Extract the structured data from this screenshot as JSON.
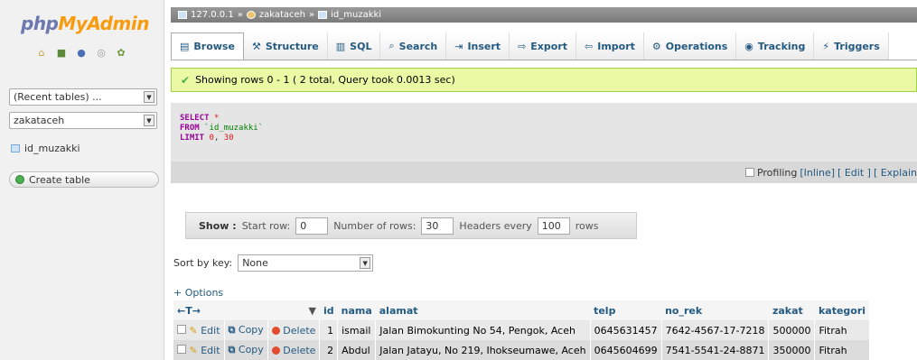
{
  "logo": {
    "part1": "php",
    "part2": "MyAdmin"
  },
  "nav": {
    "icons": [
      "home-icon",
      "exit-icon",
      "help-icon",
      "docs-icon",
      "settings-icon"
    ],
    "recent_tables": "(Recent tables) ...",
    "database": "zakataceh",
    "table": "id_muzakki",
    "create_table": "Create table"
  },
  "breadcrumb": {
    "server": "127.0.0.1",
    "database": "zakataceh",
    "table": "id_muzakki",
    "sep": "»"
  },
  "tabs": [
    {
      "label": "Browse",
      "icon": "▤",
      "active": true
    },
    {
      "label": "Structure",
      "icon": "⚒"
    },
    {
      "label": "SQL",
      "icon": "▥"
    },
    {
      "label": "Search",
      "icon": "⌕"
    },
    {
      "label": "Insert",
      "icon": "⇥"
    },
    {
      "label": "Export",
      "icon": "⇨"
    },
    {
      "label": "Import",
      "icon": "⇦"
    },
    {
      "label": "Operations",
      "icon": "⚙"
    },
    {
      "label": "Tracking",
      "icon": "◉"
    },
    {
      "label": "Triggers",
      "icon": "⚡"
    }
  ],
  "success_message": "Showing rows 0 - 1 ( 2 total, Query took 0.0013 sec)",
  "sql": {
    "select": "SELECT",
    "star": "*",
    "from": "FROM",
    "table": "`id_muzakki`",
    "limit": "LIMIT",
    "offset": "0",
    "comma": ",",
    "count": "30"
  },
  "profiling": {
    "label": "Profiling",
    "inline": "[Inline]",
    "edit": "[ Edit ]",
    "explain": "[ Explain"
  },
  "navigation": {
    "show": "Show :",
    "start_row_label": "Start row:",
    "start_row": "0",
    "rows_label": "Number of rows:",
    "rows": "30",
    "headers_label": "Headers every",
    "headers": "100",
    "rows_suffix": "rows"
  },
  "sort": {
    "label": "Sort by key:",
    "value": "None"
  },
  "options_link": "+ Options",
  "table": {
    "arrows": "←T→",
    "columns": [
      "id",
      "nama",
      "alamat",
      "telp",
      "no_rek",
      "zakat",
      "kategori"
    ],
    "actions": {
      "edit": "Edit",
      "copy": "Copy",
      "delete": "Delete"
    },
    "rows": [
      [
        "1",
        "ismail",
        "Jalan Bimokunting No 54, Pengok, Aceh",
        "0645631457",
        "7642-4567-17-7218",
        "500000",
        "Fitrah"
      ],
      [
        "2",
        "Abdul",
        "Jalan Jatayu, No 219, Ihokseumawe, Aceh",
        "0645604699",
        "7541-5541-24-8871",
        "350000",
        "Fitrah"
      ]
    ]
  }
}
